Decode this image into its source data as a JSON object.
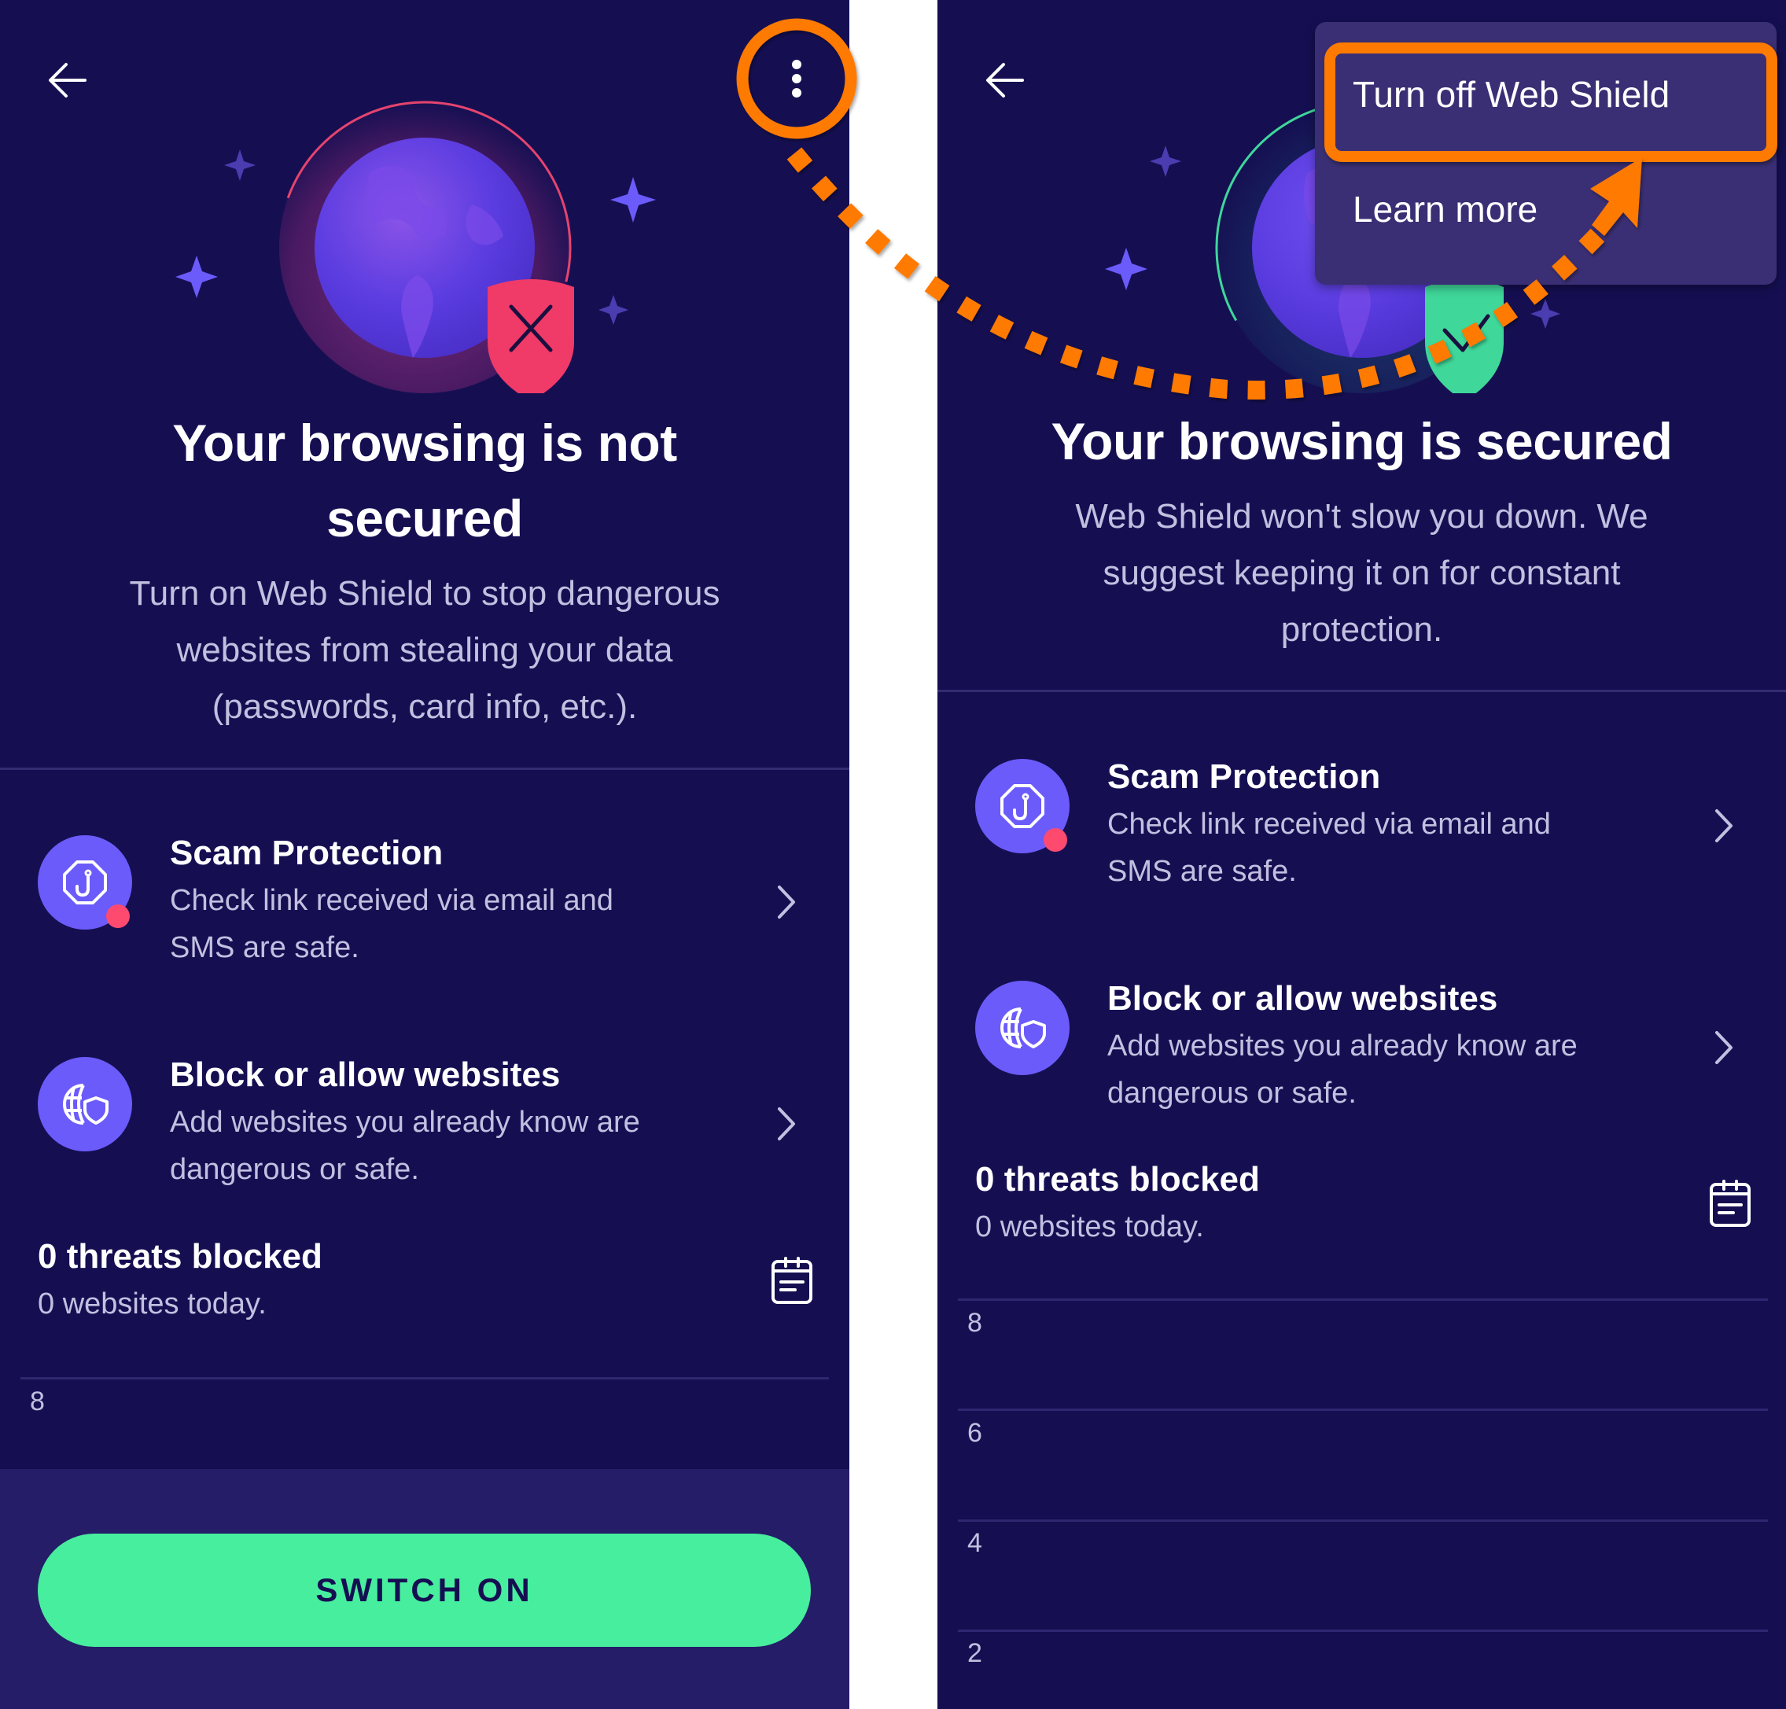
{
  "colors": {
    "background": "#150f52",
    "bottom_area": "#251d68",
    "accent_purple": "#6b5bfa",
    "badge_red": "#ff4a70",
    "shield_red": "#f03a68",
    "shield_green": "#3fd79a",
    "button_green": "#47ee9e",
    "annotation_orange": "#ff7a00",
    "menu_bg": "#3a2f74",
    "text_primary": "#ffffff",
    "text_secondary": "#c3bfe0"
  },
  "left_screen": {
    "state": "not-secured",
    "header": {
      "back_icon": "arrow-left-icon",
      "menu_icon": "more-vertical-icon"
    },
    "illustration": {
      "globe_icon": "globe-icon",
      "shield_icon": "shield-x-icon"
    },
    "title_lines": [
      "Your browsing is not",
      "secured"
    ],
    "subtitle_lines": [
      "Turn on Web Shield to stop dangerous",
      "websites from stealing your data",
      "(passwords, card info, etc.)."
    ],
    "features": [
      {
        "title": "Scam Protection",
        "desc_lines": [
          "Check link received via email and",
          "SMS are safe."
        ],
        "icon": "fishhook-octagon-icon",
        "has_badge": true
      },
      {
        "title": "Block or allow websites",
        "desc_lines": [
          "Add websites you already know are",
          "dangerous or safe."
        ],
        "icon": "globe-shield-icon",
        "has_badge": false
      }
    ],
    "threats": {
      "title": "0 threats blocked",
      "subtitle": "0 websites today.",
      "icon": "calendar-icon"
    },
    "chart_ticks": [
      "8"
    ],
    "button_label": "SWITCH ON"
  },
  "right_screen": {
    "state": "secured",
    "header": {
      "back_icon": "arrow-left-icon"
    },
    "illustration": {
      "globe_icon": "globe-icon",
      "shield_icon": "shield-check-icon"
    },
    "title_lines": [
      "Your browsing is secured"
    ],
    "subtitle_lines": [
      "Web Shield won't slow you down. We",
      "suggest keeping it on for constant",
      "protection."
    ],
    "menu": {
      "items": [
        "Turn off Web Shield",
        "Learn more"
      ],
      "highlighted_index": 0
    },
    "features": [
      {
        "title": "Scam Protection",
        "desc_lines": [
          "Check link received via email and",
          "SMS are safe."
        ],
        "icon": "fishhook-octagon-icon",
        "has_badge": true
      },
      {
        "title": "Block or allow websites",
        "desc_lines": [
          "Add websites you already know are",
          "dangerous or safe."
        ],
        "icon": "globe-shield-icon",
        "has_badge": false
      }
    ],
    "threats": {
      "title": "0 threats blocked",
      "subtitle": "0 websites today.",
      "icon": "calendar-icon"
    },
    "chart_ticks": [
      "8",
      "6",
      "4",
      "2"
    ]
  },
  "annotation": {
    "description": "dotted arrow from the overflow menu button to the 'Turn off Web Shield' item",
    "from": "more-vertical-icon",
    "to": "Turn off Web Shield"
  }
}
